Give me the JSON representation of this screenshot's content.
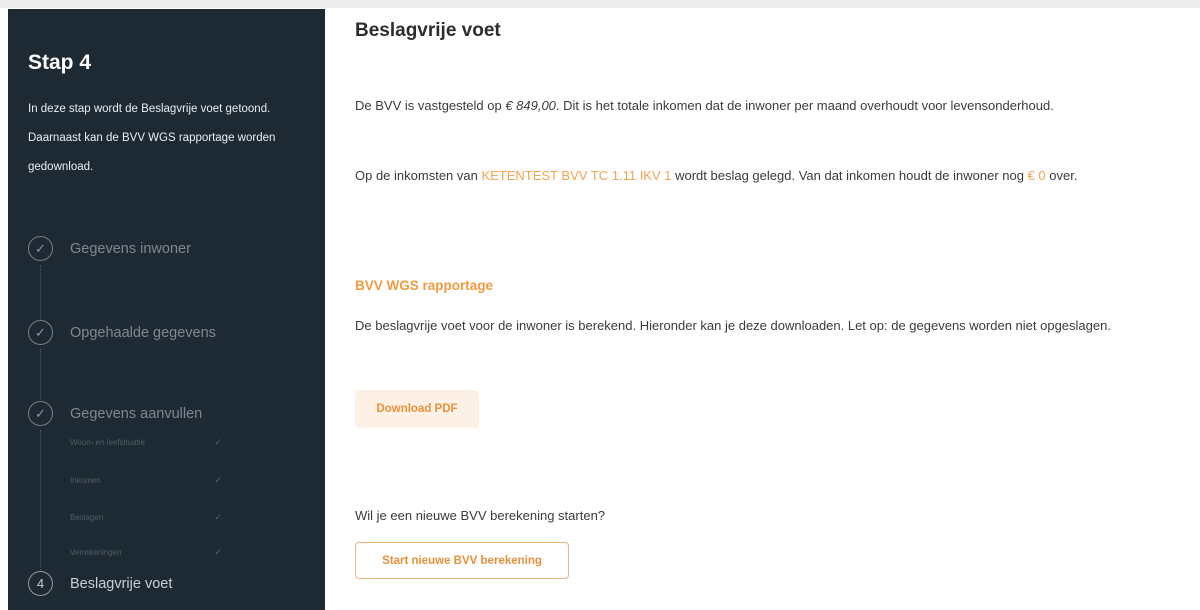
{
  "sidebar": {
    "title": "Stap 4",
    "description": "In deze stap wordt de Beslagvrije voet getoond. Daarnaast kan de BVV WGS rapportage worden gedownload.",
    "steps": [
      {
        "marker": "✓",
        "label": "Gegevens inwoner"
      },
      {
        "marker": "✓",
        "label": "Opgehaalde gegevens"
      },
      {
        "marker": "✓",
        "label": "Gegevens aanvullen"
      },
      {
        "marker": "4",
        "label": "Beslagvrije voet"
      }
    ],
    "substeps": [
      {
        "label": "Woon- en leefsituatie",
        "check": "✓"
      },
      {
        "label": "Inkomen",
        "check": "✓"
      },
      {
        "label": "Beslagen",
        "check": "✓"
      },
      {
        "label": "Verrekeningen",
        "check": "✓"
      }
    ]
  },
  "main": {
    "title": "Beslagvrije voet",
    "bvv": {
      "line1_pre": "De BVV is vastgesteld op ",
      "amount": "€ 849,00",
      "line1_post": ". Dit is het totale inkomen dat de inwoner per maand overhoudt voor levensonderhoud.",
      "line2_pre": "Op de inkomsten van ",
      "source": "KETENTEST BVV TC 1.11 IKV 1",
      "line2_post": " wordt beslag gelegd. Van dat inkomen houdt de inwoner nog ",
      "remaining": "€ 0",
      "line2_end": " over."
    },
    "report": {
      "heading": "BVV WGS rapportage",
      "text": "De beslagvrije voet voor de inwoner is berekend. Hieronder kan je deze downloaden. Let op: de gegevens worden niet opgeslagen.",
      "download_label": "Download PDF"
    },
    "restart": {
      "question": "Wil je een nieuwe BVV berekening starten?",
      "button_label": "Start nieuwe BVV berekening"
    }
  },
  "colors": {
    "sidebar_bg": "#1e2a33",
    "accent": "#f29a3e"
  }
}
